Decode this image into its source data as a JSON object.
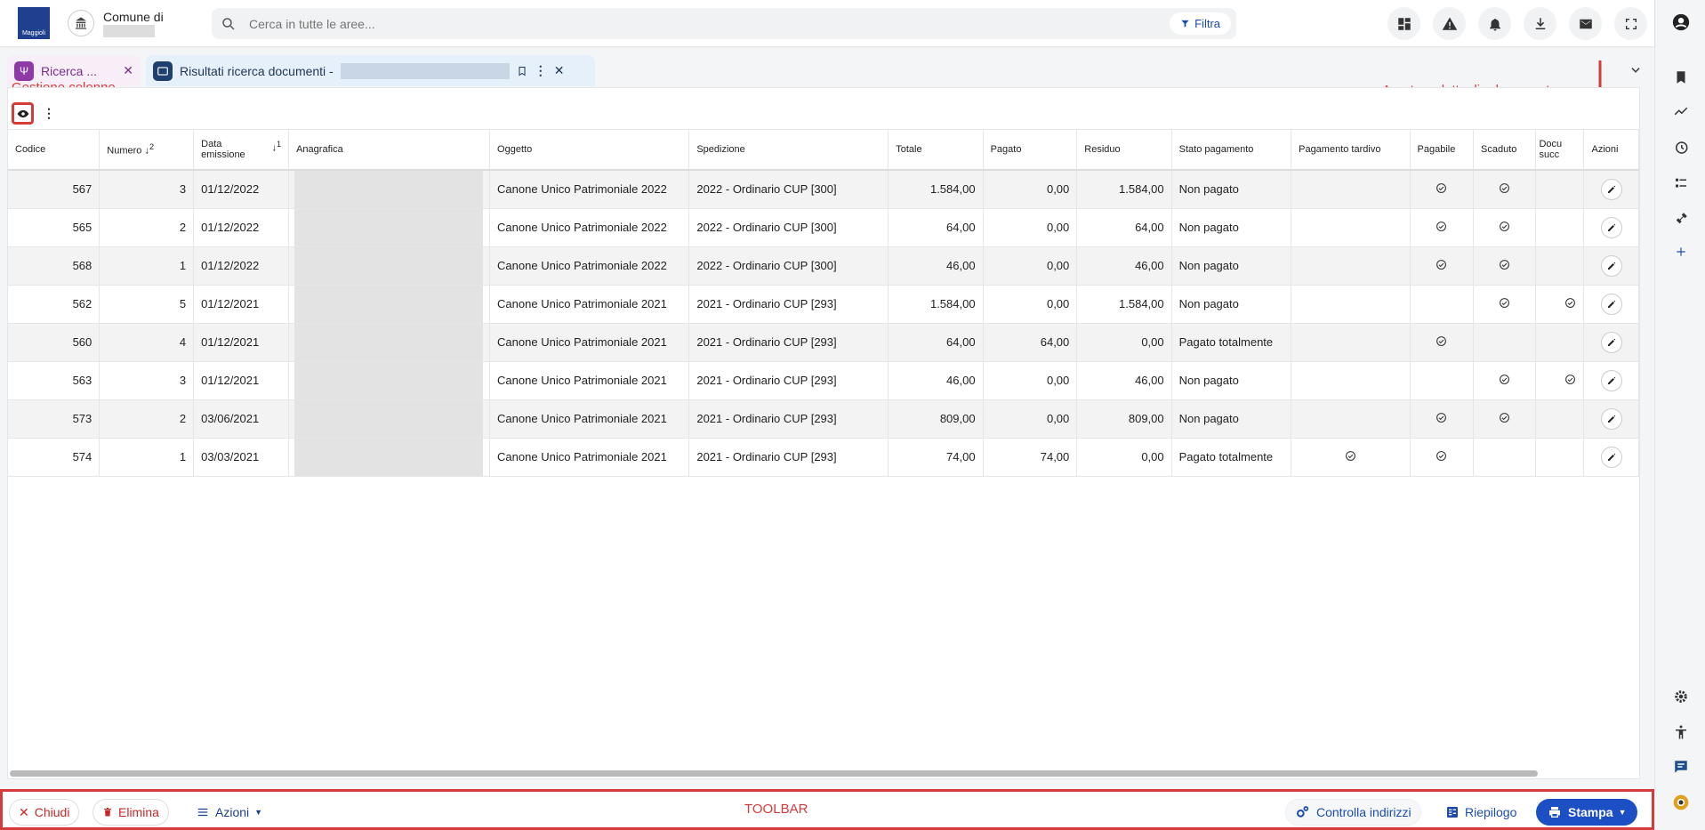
{
  "header": {
    "logo_text": "Maggioli",
    "comune_label": "Comune di",
    "search_placeholder": "Cerca in tutte le aree...",
    "filter_label": "Filtra"
  },
  "tabs": [
    {
      "label": "Ricerca ...",
      "color": "#7b2d8e"
    },
    {
      "label": "Risultati ricerca documenti -",
      "color": "#1f3553"
    }
  ],
  "annotations": {
    "columns_manager": "Gestione colonne",
    "open_detail": "Apertura dettaglio documento",
    "toolbar": "TOOLBAR"
  },
  "table": {
    "headers": {
      "codice": "Codice",
      "numero": "Numero",
      "numero_sort": "2",
      "data_line1": "Data",
      "data_line2": "emissione",
      "data_sort": "1",
      "anagrafica": "Anagrafica",
      "oggetto": "Oggetto",
      "spedizione": "Spedizione",
      "totale": "Totale",
      "pagato": "Pagato",
      "residuo": "Residuo",
      "stato": "Stato pagamento",
      "tardivo": "Pagamento tardivo",
      "pagabile": "Pagabile",
      "scaduto": "Scaduto",
      "doc_line1": "Docu",
      "doc_line2": "succ",
      "azioni": "Azioni"
    },
    "rows": [
      {
        "codice": "567",
        "numero": "3",
        "data": "01/12/2022",
        "oggetto": "Canone Unico Patrimoniale 2022",
        "spedizione": "2022 - Ordinario CUP [300]",
        "totale": "1.584,00",
        "pagato": "0,00",
        "residuo": "1.584,00",
        "stato": "Non pagato",
        "tardivo": false,
        "pagabile": true,
        "scaduto": true,
        "doc": false
      },
      {
        "codice": "565",
        "numero": "2",
        "data": "01/12/2022",
        "oggetto": "Canone Unico Patrimoniale 2022",
        "spedizione": "2022 - Ordinario CUP [300]",
        "totale": "64,00",
        "pagato": "0,00",
        "residuo": "64,00",
        "stato": "Non pagato",
        "tardivo": false,
        "pagabile": true,
        "scaduto": true,
        "doc": false
      },
      {
        "codice": "568",
        "numero": "1",
        "data": "01/12/2022",
        "oggetto": "Canone Unico Patrimoniale 2022",
        "spedizione": "2022 - Ordinario CUP [300]",
        "totale": "46,00",
        "pagato": "0,00",
        "residuo": "46,00",
        "stato": "Non pagato",
        "tardivo": false,
        "pagabile": true,
        "scaduto": true,
        "doc": false
      },
      {
        "codice": "562",
        "numero": "5",
        "data": "01/12/2021",
        "oggetto": "Canone Unico Patrimoniale 2021",
        "spedizione": "2021 - Ordinario CUP [293]",
        "totale": "1.584,00",
        "pagato": "0,00",
        "residuo": "1.584,00",
        "stato": "Non pagato",
        "tardivo": false,
        "pagabile": false,
        "scaduto": true,
        "doc": true
      },
      {
        "codice": "560",
        "numero": "4",
        "data": "01/12/2021",
        "oggetto": "Canone Unico Patrimoniale 2021",
        "spedizione": "2021 - Ordinario CUP [293]",
        "totale": "64,00",
        "pagato": "64,00",
        "residuo": "0,00",
        "stato": "Pagato totalmente",
        "tardivo": false,
        "pagabile": true,
        "scaduto": false,
        "doc": false
      },
      {
        "codice": "563",
        "numero": "3",
        "data": "01/12/2021",
        "oggetto": "Canone Unico Patrimoniale 2021",
        "spedizione": "2021 - Ordinario CUP [293]",
        "totale": "46,00",
        "pagato": "0,00",
        "residuo": "46,00",
        "stato": "Non pagato",
        "tardivo": false,
        "pagabile": false,
        "scaduto": true,
        "doc": true
      },
      {
        "codice": "573",
        "numero": "2",
        "data": "03/06/2021",
        "oggetto": "Canone Unico Patrimoniale 2021",
        "spedizione": "2021 - Ordinario CUP [293]",
        "totale": "809,00",
        "pagato": "0,00",
        "residuo": "809,00",
        "stato": "Non pagato",
        "tardivo": false,
        "pagabile": true,
        "scaduto": true,
        "doc": false
      },
      {
        "codice": "574",
        "numero": "1",
        "data": "03/03/2021",
        "oggetto": "Canone Unico Patrimoniale 2021",
        "spedizione": "2021 - Ordinario CUP [293]",
        "totale": "74,00",
        "pagato": "74,00",
        "residuo": "0,00",
        "stato": "Pagato totalmente",
        "tardivo": true,
        "pagabile": true,
        "scaduto": false,
        "doc": false
      }
    ]
  },
  "toolbar": {
    "chiudi": "Chiudi",
    "elimina": "Elimina",
    "azioni": "Azioni",
    "controlla": "Controlla indirizzi",
    "riepilogo": "Riepilogo",
    "stampa": "Stampa"
  },
  "colors": {
    "accent_blue": "#1d4fc4",
    "annotation_red": "#d63b3b",
    "tab_purple": "#7b2d8e"
  }
}
